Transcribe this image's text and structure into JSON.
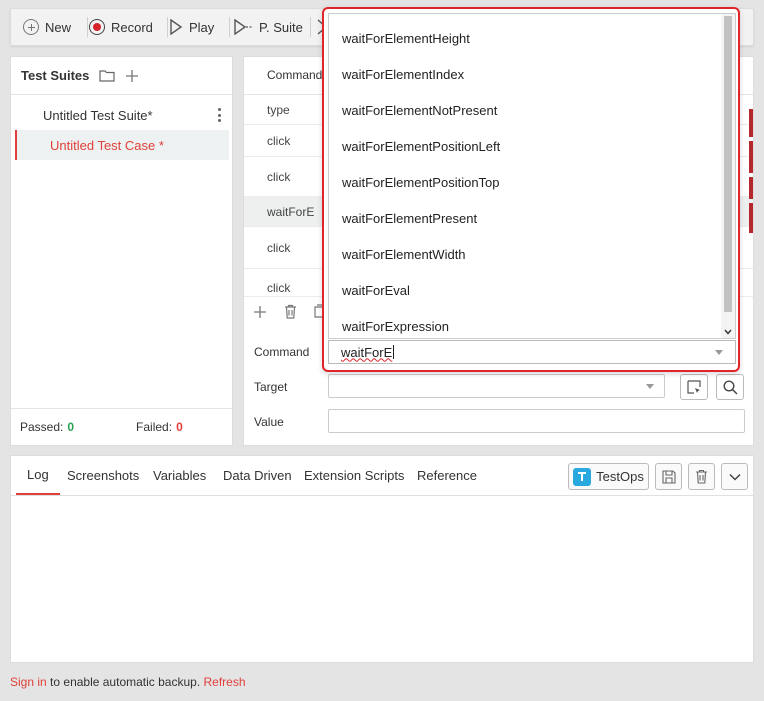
{
  "toolbar": {
    "new_label": "New",
    "record_label": "Record",
    "play_label": "Play",
    "psuite_label": "P. Suite"
  },
  "left_panel": {
    "title": "Test Suites",
    "suite_name": "Untitled Test Suite*",
    "case_name": "Untitled Test Case *",
    "passed_label": "Passed:",
    "passed_count": "0",
    "failed_label": "Failed:",
    "failed_count": "0"
  },
  "command_table": {
    "header": "Command",
    "rows": [
      "type",
      "click",
      "click",
      "waitForE",
      "click",
      "click"
    ]
  },
  "editor": {
    "command_label": "Command",
    "command_value": "waitForE",
    "target_label": "Target",
    "value_label": "Value"
  },
  "dropdown": {
    "items": [
      "waitForElementHeight",
      "waitForElementIndex",
      "waitForElementNotPresent",
      "waitForElementPositionLeft",
      "waitForElementPositionTop",
      "waitForElementPresent",
      "waitForElementWidth",
      "waitForEval",
      "waitForExpression"
    ]
  },
  "bottom_tabs": {
    "tabs": [
      "Log",
      "Screenshots",
      "Variables",
      "Data Driven",
      "Extension Scripts",
      "Reference"
    ],
    "testops_label": "TestOps"
  },
  "status_bar": {
    "sign_in": "Sign in",
    "middle": "to enable automatic backup.",
    "refresh": "Refresh"
  },
  "colors": {
    "accent": "#e0403a",
    "highlight_border": "#e0252a",
    "passed": "#2aa152"
  }
}
